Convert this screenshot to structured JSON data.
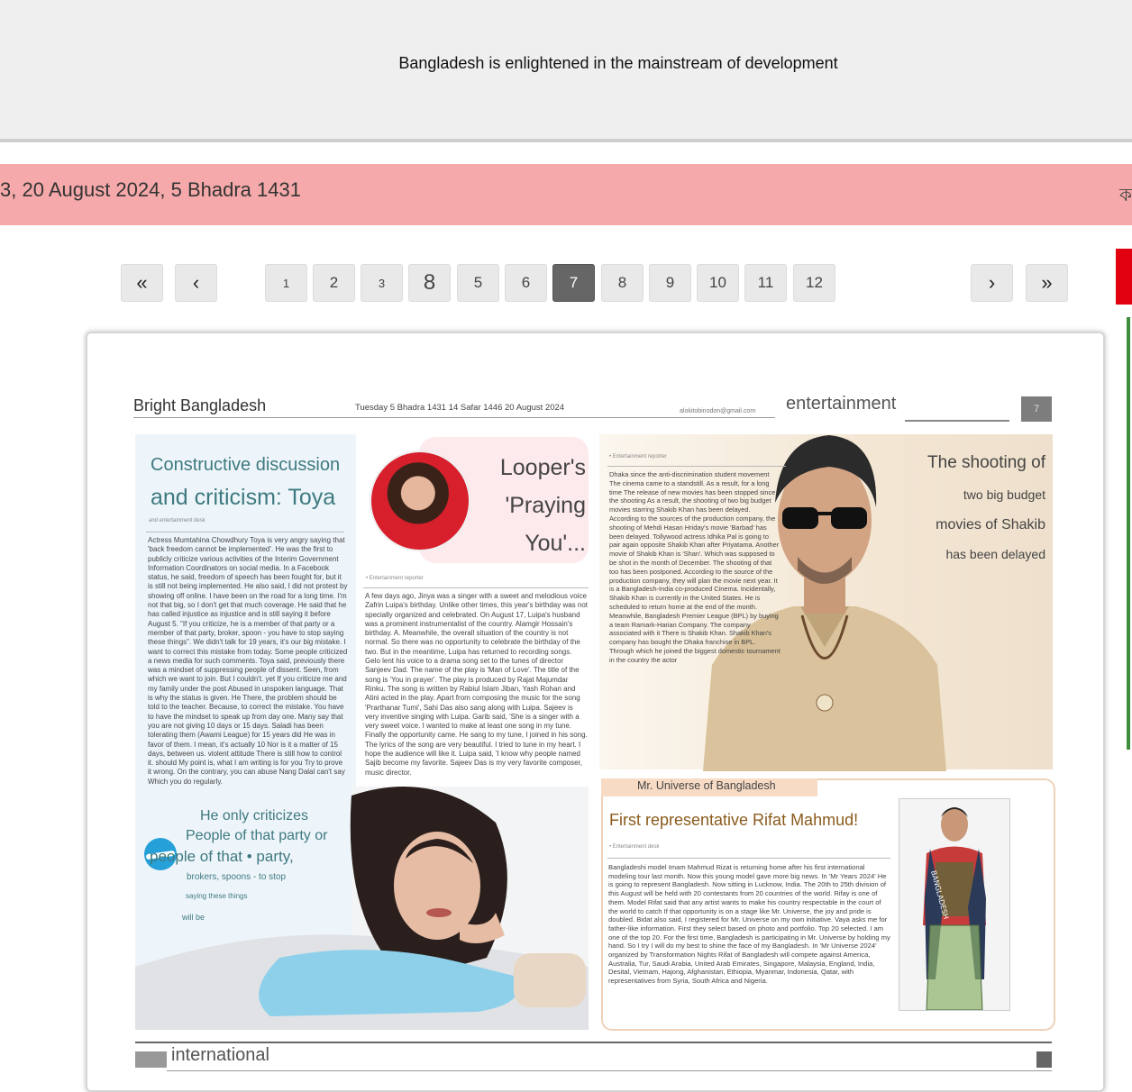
{
  "banner": {
    "title": "Bangladesh is enlightened in the mainstream of development"
  },
  "date_bar": {
    "date": "3, 20 August 2024, 5 Bhadra 1431",
    "edge_glyph": "ক"
  },
  "pagination": {
    "first": "«",
    "prev": "‹",
    "next": "›",
    "last": "»",
    "pages": [
      "1",
      "2",
      "3",
      "8",
      "5",
      "6",
      "7",
      "8",
      "9",
      "10",
      "11",
      "12"
    ],
    "active": "7"
  },
  "paper": {
    "masthead": "Bright Bangladesh",
    "issue_date": "Tuesday 5 Bhadra 1431 14 Safar 1446 20 August 2024",
    "email": "alokitobinodon@gmail.com",
    "section": "entertainment",
    "page_number": "7",
    "toya": {
      "title_line1": "Constructive discussion",
      "title_line2": "and criticism: Toya",
      "byline": "and entertainment desk",
      "body": "Actress Mumtahina Chowdhury Toya is very angry saying that 'back freedom cannot be implemented'. He was the first to publicly criticize various activities of the Interim Government Information Coordinators on social media. In a Facebook status, he said, freedom of speech has been fought for, but it is still not being implemented. He also said, I did not protest by showing off online. I have been on the road for a long time. I'm not that big, so I don't get that much coverage. He said that he has called injustice as injustice and is still saying it before August 5. \"If you criticize, he is a member of that party or a member of that party, broker, spoon - you have to stop saying these things\". We didn't talk for 19 years, it's our big mistake. I want to correct this mistake from today. Some people criticized a news media for such comments. Toya said, previously there was a mindset of suppressing people of dissent. Seen, from which we want to join. But I couldn't. yet If you criticize me and my family under the post Abused in unspoken language. That is why the status is given. He There, the problem should be told to the teacher. Because, to correct the mistake. You have to have the mindset to speak up from day one. Many say that you are not giving 10 days or 15 days. Saladi has been tolerating them (Awami League) for 15 years did He was in favor of them. I mean, it's actually 10 Nor is it a matter of 15 days, between us. violent attitude There is still how to control it. should My point is, what I am writing is for you Try to prove it wrong. On the contrary, you can abuse Nang Dalal can't say Which you do regularly.",
      "quote_lines": [
        "He only criticizes",
        "People of that party or",
        "people of that • party,",
        "brokers, spoons - to stop",
        "saying these things",
        "will be"
      ]
    },
    "looper": {
      "title": "Looper's 'Praying You'...",
      "byline": "• Entertainment reporter",
      "body": "A few days ago, Jinya was a singer with a sweet and melodious voice Zafrin Luipa's birthday. Unlike other times, this year's birthday was not specially organized and celebrated. On August 17, Luipa's husband was a prominent instrumentalist of the country. Alamgir Hossain's birthday. A. Meanwhile, the overall situation of the country is not normal. So there was no opportunity to celebrate the birthday of the two. But in the meantime, Luipa has returned to recording songs. Gelo lent his voice to a drama song set to the tunes of director Sanjeev Dad. The name of the play is 'Man of Love'. The title of the song is 'You in prayer'. The play is produced by Rajat Majumdar Rinku. The song is written by Rabiul Islam Jiban, Yash Rohan and Atini acted in the play. Apart from composing the music for the song 'Prarthanar Tumi', Sahi Das also sang along with Luipa. Sajeev is very inventive singing with Luipa. Garib said, 'She is a singer with a very sweet voice. I wanted to make at least one song in my tune. Finally the opportunity came. He sang to my tune, I joined in his song. The lyrics of the song are very beautiful. I tried to tune in my heart. I hope the audience will like it. Luipa said, 'I know why people named Sajib become my favorite. Sajeev Das is my very favorite composer, music director."
    },
    "shakib": {
      "title_lines": [
        "The shooting of",
        "two big budget",
        "movies of Shakib",
        "has been delayed"
      ],
      "byline": "• Entertainment reporter",
      "body": "Dhaka since the anti-discrimination student movement The cinema came to a standstill. As a result, for a long time The release of new movies has been stopped since the shooting As a result, the shooting of two big budget movies starring Shakib Khan has been delayed. According to the sources of the production company, the shooting of Mehdi Hasan Hriday's movie 'Barbad' has been delayed. Tollywood actress Idhika Pal is going to pair again opposite Shakib Khan after Priyatama. Another movie of Shakib Khan is 'Shan'. Which was supposed to be shot in the month of December. The shooting of that too has been postponed. According to the source of the production company, they will plan the movie next year. It is a Bangladesh-India co-produced Cinema. Incidentally, Shakib Khan is currently in the United States. He is scheduled to return home at the end of the month. Meanwhile, Bangladesh Premier League (BPL) by buying a team Ramark-Harian Company. The company associated with it There is Shakib Khan. Shakib Khan's company has bought the Dhaka franchise in BPL. Through which he joined the biggest domestic tournament in the country the actor"
    },
    "rifat": {
      "tag": "Mr. Universe of Bangladesh",
      "title": "First representative Rifat Mahmud!",
      "byline": "• Entertainment desk",
      "body": "Bangladeshi model Imam Mahmud Rizat is returning home after his first international modeling tour last month. Now this young model gave more big news. In 'Mr Years 2024' He is going to represent Bangladesh. Now sitting in Lucknow, India. The 20th to 25th division of this August will be held with 20 contestants from 20 countries of the world. Rifay is one of them. Model Rifat said that any artist wants to make his country respectable in the court of the world to catch If that opportunity is on a stage like Mr. Universe, the joy and pride is doubled. Bidat also said, I registered for Mr. Universe on my own initiative. Vaya asks me for father-like information. First they select based on photo and portfolio. Top 20 selected. I am one of the top 20. For the first time, Bangladesh is participating in Mr. Universe by holding my hand. So I try I will do my best to shine the face of my Bangladesh. In 'Mr Universe 2024' organized by Transformation Nights Rifat of Bangladesh will compete against America, Australia, Tur, Saudi Arabia, United Arab Emirates, Singapore, Malaysia, England, India, Desital, Vietnam, Hajong, Afghanistan, Ethiopia, Myanmar, Indonesia, Qatar, with representatives from Syria, South Africa and Nigeria.",
      "sash_text": "BANGLADESH"
    },
    "next_section": "international"
  },
  "colors": {
    "date_bar": "#f6a9aa",
    "accent_teal": "#3d7a80",
    "accent_brown": "#8a5b1c",
    "active_page": "#666666"
  }
}
